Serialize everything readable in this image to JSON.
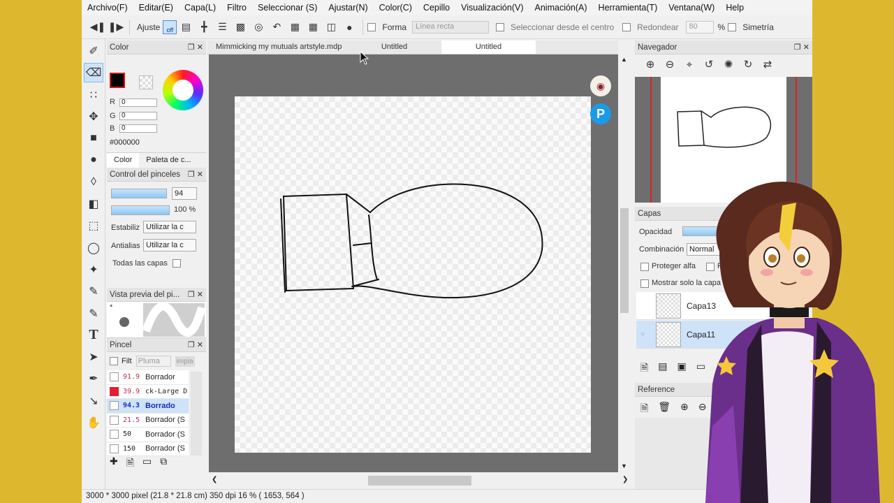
{
  "menu": [
    "Archivo(F)",
    "Editar(E)",
    "Capa(L)",
    "Filtro",
    "Seleccionar (S)",
    "Ajustar(N)",
    "Color(C)",
    "Cepillo",
    "Visualización(V)",
    "Animación(A)",
    "Herramienta(T)",
    "Ventana(W)",
    "Help"
  ],
  "toolbar": {
    "ajuste": "Ajuste",
    "off": "off",
    "forma": "Forma",
    "forma_value": "Línea recta",
    "seleccionar_centro": "Seleccionar desde el centro",
    "redondear": "Redondear",
    "redondear_value": "80",
    "percent": "%",
    "simetria": "Simetría"
  },
  "color_panel": {
    "title": "Color",
    "r": "R",
    "g": "G",
    "b": "B",
    "r_val": "0",
    "g_val": "0",
    "b_val": "0",
    "hex": "#000000",
    "tab_color": "Color",
    "tab_paleta": "Paleta de c..."
  },
  "brush_control": {
    "title": "Control del pinceles",
    "size": "94",
    "opacity": "100 %",
    "estabiliz": "Estabiliz",
    "estabiliz_value": "Utilizar la c",
    "antialias": "Antialias",
    "antialias_value": "Utilizar la c",
    "todas_capas": "Todas las capas"
  },
  "preview": {
    "title": "Vista previa del pi...",
    "star": "*"
  },
  "pincel": {
    "title": "Pincel",
    "filt": "Filt",
    "pluma": "Pluma",
    "impia": "impia",
    "items": [
      {
        "num": "91.9",
        "name": "Borrador",
        "color": "#ffffff"
      },
      {
        "num": "39.9",
        "name": "ck-Large D",
        "color": "#e02030"
      },
      {
        "num": "94.3",
        "name": "Borrado",
        "color": "#ffffff"
      },
      {
        "num": "21.5",
        "name": "Borrador (S",
        "color": "#ffffff"
      },
      {
        "num": "50",
        "name": "Borrador (S",
        "color": "#ffffff"
      },
      {
        "num": "150",
        "name": "Borrador (S",
        "color": "#ffffff"
      }
    ]
  },
  "tabs": [
    "Mimmicking my mutuals artstyle.mdp",
    "Untitled",
    "Untitled"
  ],
  "status": "3000 * 3000 pixel   (21.8 * 21.8 cm)   350 dpi   16 %   ( 1653, 564 )",
  "navegador": {
    "title": "Navegador"
  },
  "capas": {
    "title": "Capas",
    "opacidad": "Opacidad",
    "combinacion": "Combinación",
    "combinacion_value": "Normal",
    "proteger_alfa": "Proteger alfa",
    "re": "Re",
    "mostrar_solo": "Mostrar solo la capa activa",
    "layers": [
      "Capa13",
      "Capa11"
    ]
  },
  "reference": {
    "title": "Reference"
  },
  "colors": {
    "accent": "#cfe3f8",
    "canvas_bg": "#6e6e6e",
    "frame": "#ddb82f"
  }
}
